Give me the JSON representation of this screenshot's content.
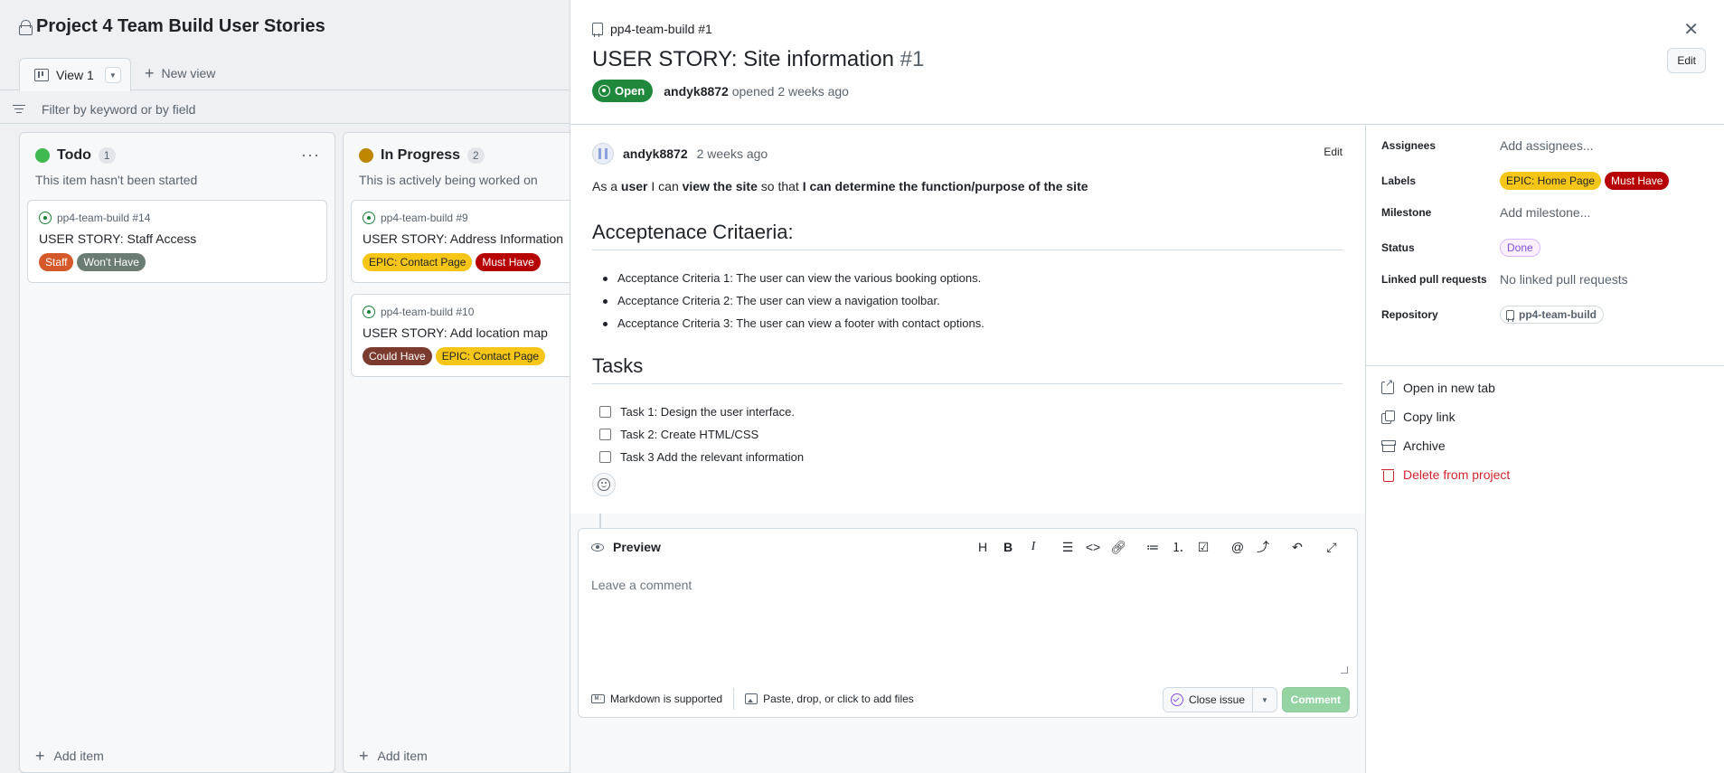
{
  "board": {
    "project_title": "Project 4 Team Build User Stories",
    "view_tab": "View 1",
    "new_view": "New view",
    "filter_placeholder": "Filter by keyword or by field",
    "columns": [
      {
        "name": "Todo",
        "count": "1",
        "description": "This item hasn't been started",
        "color": "#3fb950",
        "add_item": "Add item",
        "cards": [
          {
            "repo": "pp4-team-build #14",
            "title": "USER STORY: Staff Access",
            "labels": [
              {
                "text": "Staff",
                "bg": "#d4582a",
                "fg": "#ffffff"
              },
              {
                "text": "Won't Have",
                "bg": "#6b7d72",
                "fg": "#ffffff"
              }
            ]
          }
        ]
      },
      {
        "name": "In Progress",
        "count": "2",
        "description": "This is actively being worked on",
        "color": "#bf8700",
        "add_item": "Add item",
        "cards": [
          {
            "repo": "pp4-team-build #9",
            "title": "USER STORY: Address Information",
            "labels": [
              {
                "text": "EPIC: Contact Page",
                "bg": "#f5c518",
                "fg": "#1f2328"
              },
              {
                "text": "Must Have",
                "bg": "#b60205",
                "fg": "#ffffff"
              }
            ]
          },
          {
            "repo": "pp4-team-build #10",
            "title": "USER STORY: Add location map",
            "labels": [
              {
                "text": "Could Have",
                "bg": "#7a3b2e",
                "fg": "#ffffff"
              },
              {
                "text": "EPIC: Contact Page",
                "bg": "#f5c518",
                "fg": "#1f2328"
              }
            ]
          }
        ]
      }
    ]
  },
  "panel": {
    "repo": "pp4-team-build #1",
    "title": "USER STORY: Site information",
    "number": "#1",
    "edit": "Edit",
    "state": "Open",
    "author": "andyk8872",
    "opened_text": "opened 2 weeks ago",
    "comment": {
      "author": "andyk8872",
      "time": "2 weeks ago",
      "edit": "Edit",
      "story": {
        "p1": "As a ",
        "b1": "user",
        "p2": " I can ",
        "b2": "view the site",
        "p3": " so that ",
        "b3": "I can determine the function/purpose of the site"
      },
      "criteria_heading": "Acceptenace Critaeria:",
      "criteria": [
        "Acceptance Criteria 1: The user can view the various booking options.",
        "Acceptance Criteria 2: The user can view a navigation toolbar.",
        "Acceptance Criteria 3: The user can view a footer with contact options."
      ],
      "tasks_heading": "Tasks",
      "tasks": [
        "Task 1: Design the user interface.",
        "Task 2: Create HTML/CSS",
        "Task 3 Add the relevant information"
      ]
    },
    "composer": {
      "preview": "Preview",
      "placeholder": "Leave a comment",
      "markdown": "Markdown is supported",
      "attach": "Paste, drop, or click to add files",
      "close_issue": "Close issue",
      "comment": "Comment"
    },
    "fields": {
      "assignees_label": "Assignees",
      "assignees_value": "Add assignees...",
      "labels_label": "Labels",
      "labels": [
        {
          "text": "EPIC: Home Page",
          "bg": "#f5c518",
          "fg": "#1f2328"
        },
        {
          "text": "Must Have",
          "bg": "#b60205",
          "fg": "#ffffff"
        }
      ],
      "milestone_label": "Milestone",
      "milestone_value": "Add milestone...",
      "status_label": "Status",
      "status_value": "Done",
      "pr_label": "Linked pull requests",
      "pr_value": "No linked pull requests",
      "repo_label": "Repository",
      "repo_value": "pp4-team-build"
    },
    "actions": {
      "open_tab": "Open in new tab",
      "copy_link": "Copy link",
      "archive": "Archive",
      "delete": "Delete from project"
    }
  }
}
